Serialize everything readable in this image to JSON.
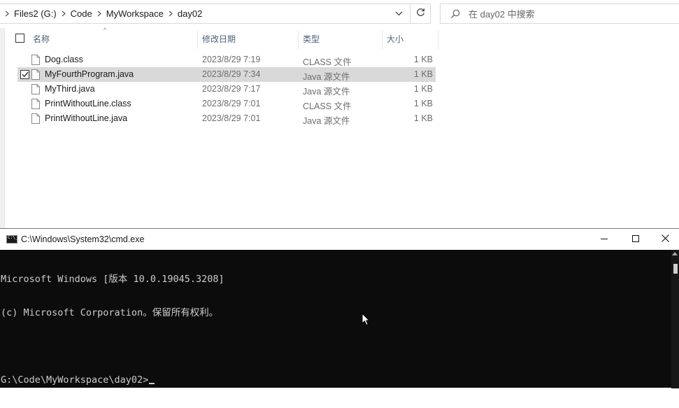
{
  "explorer": {
    "breadcrumb": [
      "Files2 (G:)",
      "Code",
      "MyWorkspace",
      "day02"
    ],
    "search_placeholder": "在 day02 中搜索",
    "columns": {
      "name": "名称",
      "date": "修改日期",
      "type": "类型",
      "size": "大小"
    },
    "files": [
      {
        "name": "Dog.class",
        "date": "2023/8/29 7:19",
        "type": "CLASS 文件",
        "size": "1 KB",
        "selected": false
      },
      {
        "name": "MyFourthProgram.java",
        "date": "2023/8/29 7:34",
        "type": "Java 源文件",
        "size": "1 KB",
        "selected": true
      },
      {
        "name": "MyThird.java",
        "date": "2023/8/29 7:17",
        "type": "Java 源文件",
        "size": "1 KB",
        "selected": false
      },
      {
        "name": "PrintWithoutLine.class",
        "date": "2023/8/29 7:01",
        "type": "CLASS 文件",
        "size": "1 KB",
        "selected": false
      },
      {
        "name": "PrintWithoutLine.java",
        "date": "2023/8/29 7:01",
        "type": "Java 源文件",
        "size": "1 KB",
        "selected": false
      }
    ]
  },
  "cmd": {
    "title": "C:\\Windows\\System32\\cmd.exe",
    "lines": [
      "Microsoft Windows [版本 10.0.19045.3208]",
      "(c) Microsoft Corporation。保留所有权利。"
    ],
    "prompt": "G:\\Code\\MyWorkspace\\day02>"
  },
  "icons": {
    "breadcrumb_sep": "chevron-right-icon",
    "refresh": "refresh-icon",
    "search": "search-icon",
    "file": "document-icon",
    "minimize": "minimize-icon",
    "maximize": "maximize-icon",
    "close": "close-icon"
  },
  "colors": {
    "selected_row": "#d9d9d9",
    "console_bg": "#0c0c0c",
    "console_text": "#cccccc",
    "header_text": "#4c607a"
  }
}
